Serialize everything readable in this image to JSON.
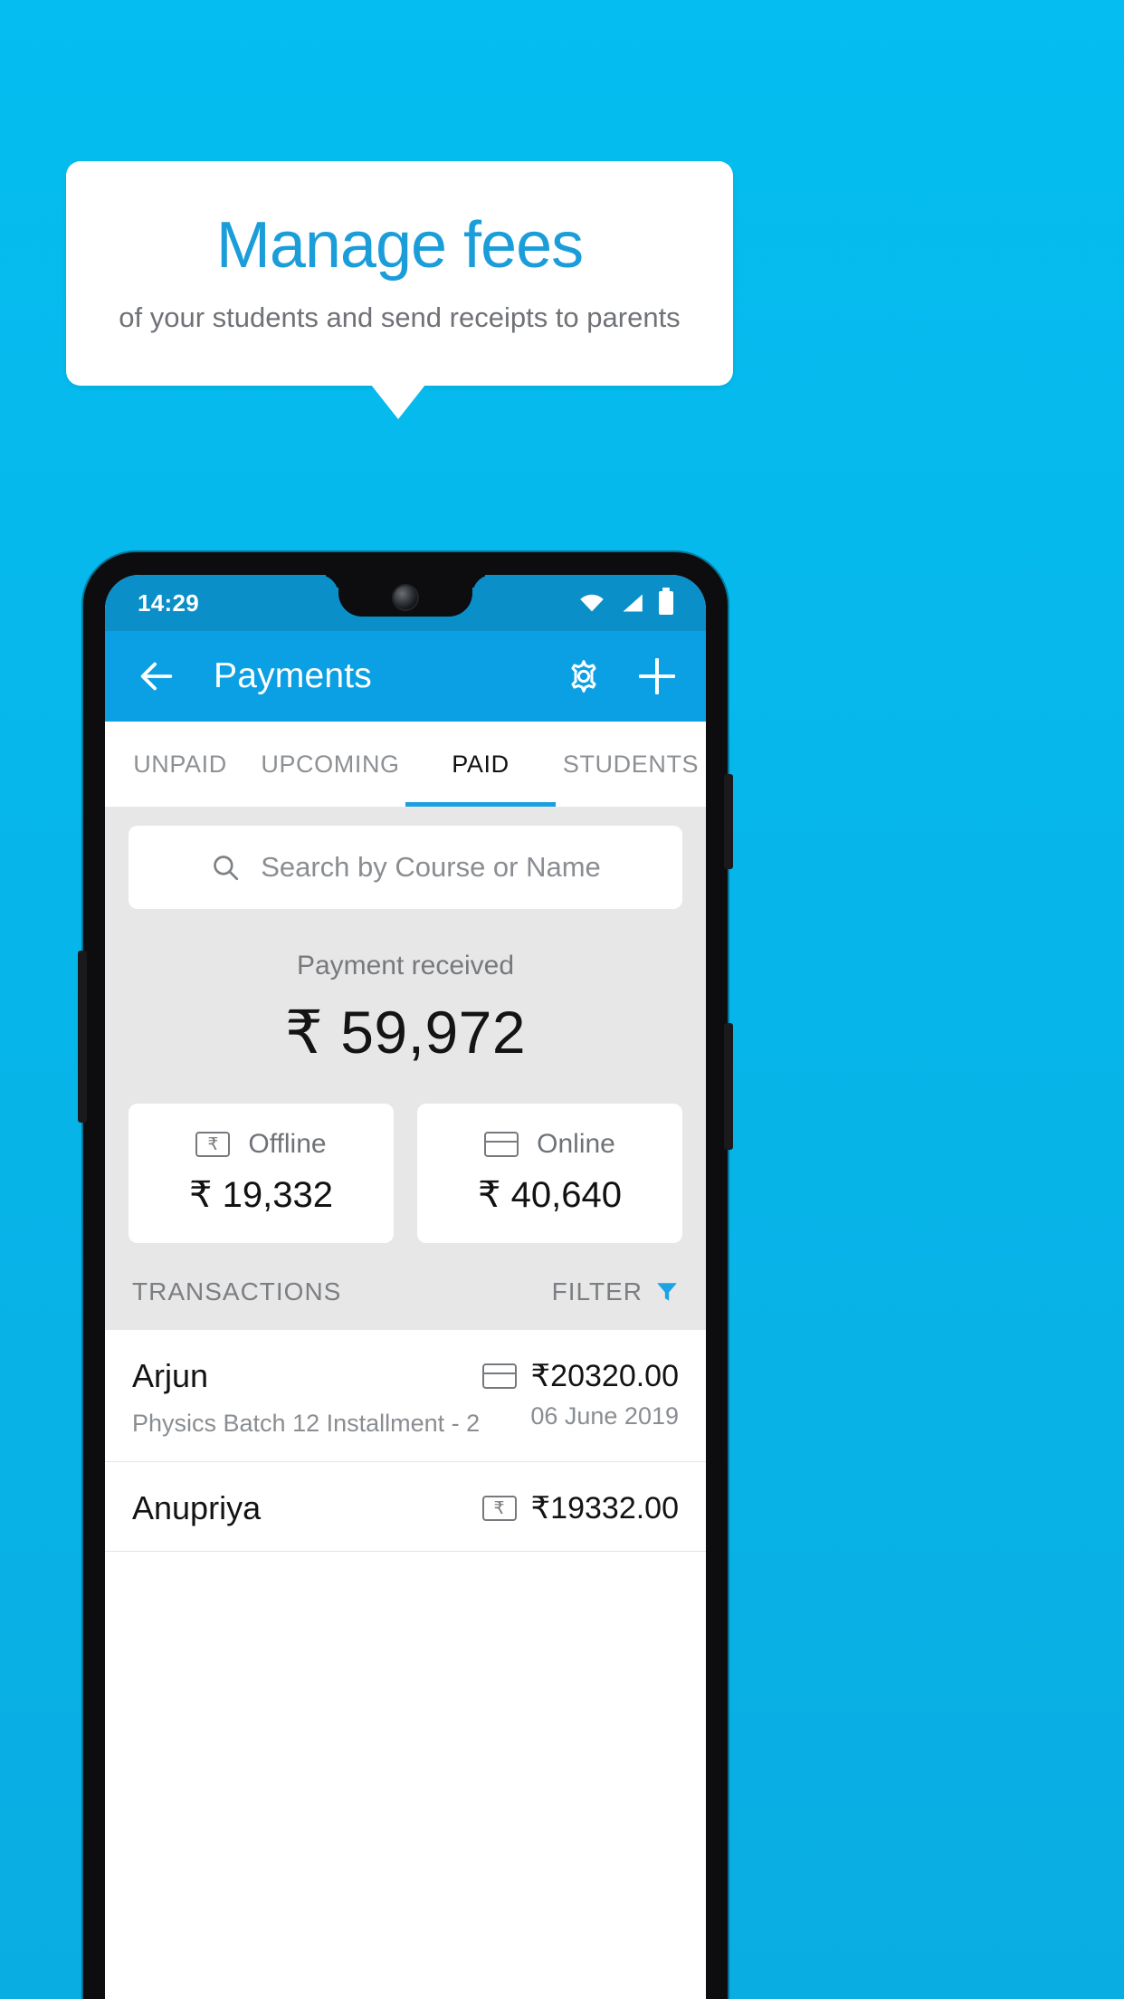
{
  "promo": {
    "title": "Manage fees",
    "subtitle": "of your students and send receipts to parents",
    "background_color": "#05bdf0",
    "title_color": "#1b9dd9"
  },
  "statusbar": {
    "time": "14:29",
    "icons": [
      "wifi-icon",
      "signal-icon",
      "battery-icon"
    ],
    "background_color": "#0a8fc9"
  },
  "appbar": {
    "back_icon": "back-arrow-icon",
    "title": "Payments",
    "settings_icon": "gear-icon",
    "add_icon": "plus-icon",
    "background_color": "#0ba0e3"
  },
  "tabs": [
    {
      "label": "UNPAID",
      "active": false
    },
    {
      "label": "UPCOMING",
      "active": false
    },
    {
      "label": "PAID",
      "active": true
    },
    {
      "label": "STUDENTS",
      "active": false
    }
  ],
  "search": {
    "placeholder": "Search by Course or Name",
    "value": "",
    "icon": "search-icon"
  },
  "summary": {
    "label": "Payment received",
    "amount": "₹ 59,972"
  },
  "methods": [
    {
      "icon": "rupee-note-icon",
      "label": "Offline",
      "amount": "₹ 19,332"
    },
    {
      "icon": "credit-card-icon",
      "label": "Online",
      "amount": "₹ 40,640"
    }
  ],
  "transactions_header": {
    "title": "TRANSACTIONS",
    "filter_label": "FILTER",
    "filter_icon": "funnel-icon",
    "filter_color": "#1ca3e3"
  },
  "transactions": [
    {
      "name": "Arjun",
      "course": "Physics Batch 12 Installment - 2",
      "amount": "₹20320.00",
      "date": "06 June 2019",
      "method_icon": "credit-card-icon"
    },
    {
      "name": "Anupriya",
      "course": "",
      "amount": "₹19332.00",
      "date": "",
      "method_icon": "rupee-note-icon"
    }
  ]
}
